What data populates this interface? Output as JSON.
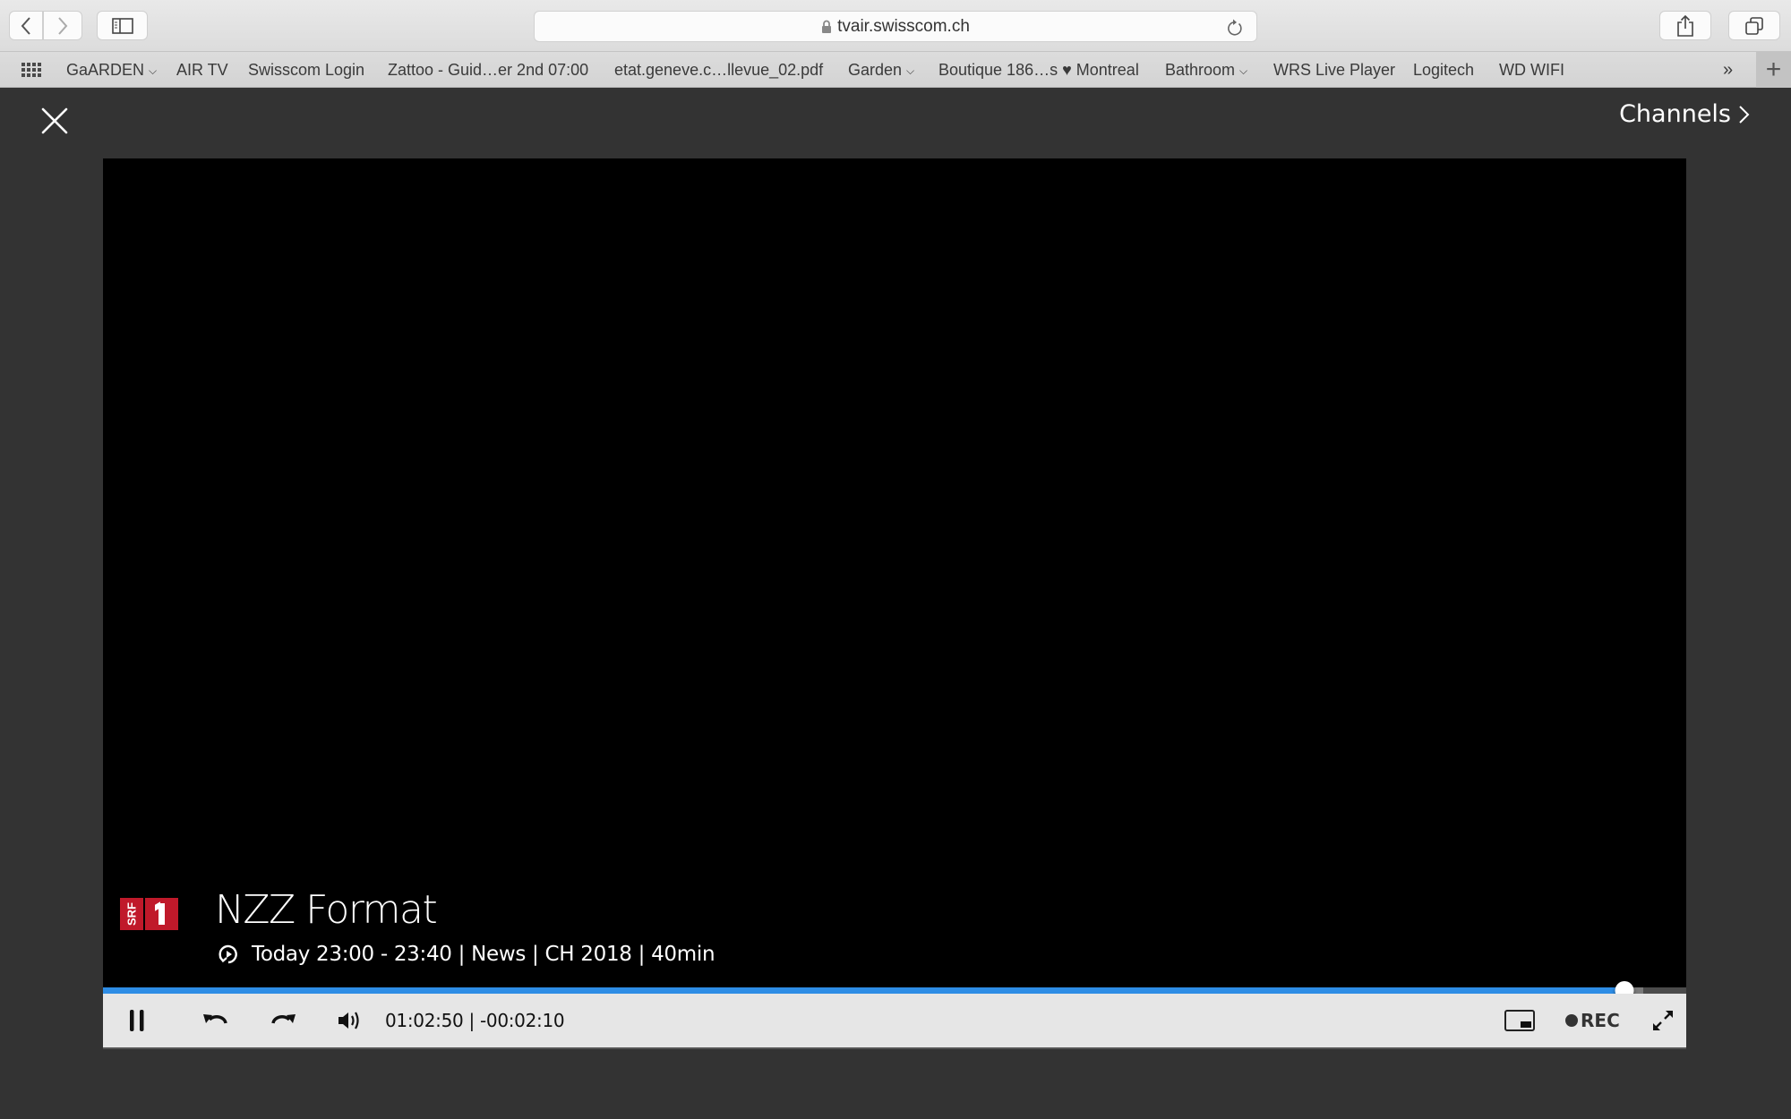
{
  "browser": {
    "url": "tvair.swisscom.ch",
    "bookmarks": [
      {
        "label": "GaARDEN",
        "folder": true
      },
      {
        "label": "AIR TV",
        "folder": false
      },
      {
        "label": "Swisscom Login",
        "folder": false
      },
      {
        "label": "Zattoo - Guid…er 2nd 07:00",
        "folder": false
      },
      {
        "label": "etat.geneve.c…llevue_02.pdf",
        "folder": false
      },
      {
        "label": "Garden",
        "folder": true
      },
      {
        "label": "Boutique 186…s ♥ Montreal",
        "folder": false
      },
      {
        "label": "Bathroom",
        "folder": true
      },
      {
        "label": "WRS Live Player",
        "folder": false
      },
      {
        "label": "Logitech",
        "folder": false
      },
      {
        "label": "WD WIFI",
        "folder": false
      }
    ],
    "more_bookmarks": "»",
    "new_tab": "+"
  },
  "player": {
    "channels_label": "Channels",
    "channel": {
      "name": "SRF 1",
      "logo_text": "SRF",
      "logo_number": "1",
      "brand_color": "#c0192a"
    },
    "show_title": "NZZ Format",
    "show_meta": "Today 23:00 - 23:40 | News | CH 2018 | 40min",
    "time_elapsed": "01:02:50",
    "time_remaining": "-00:02:10",
    "time_readout": "01:02:50 | -00:02:10",
    "progress_fraction": 0.961,
    "buffered_fraction": 0.973,
    "progress_color": "#2e8de5",
    "rec_label": "REC"
  }
}
